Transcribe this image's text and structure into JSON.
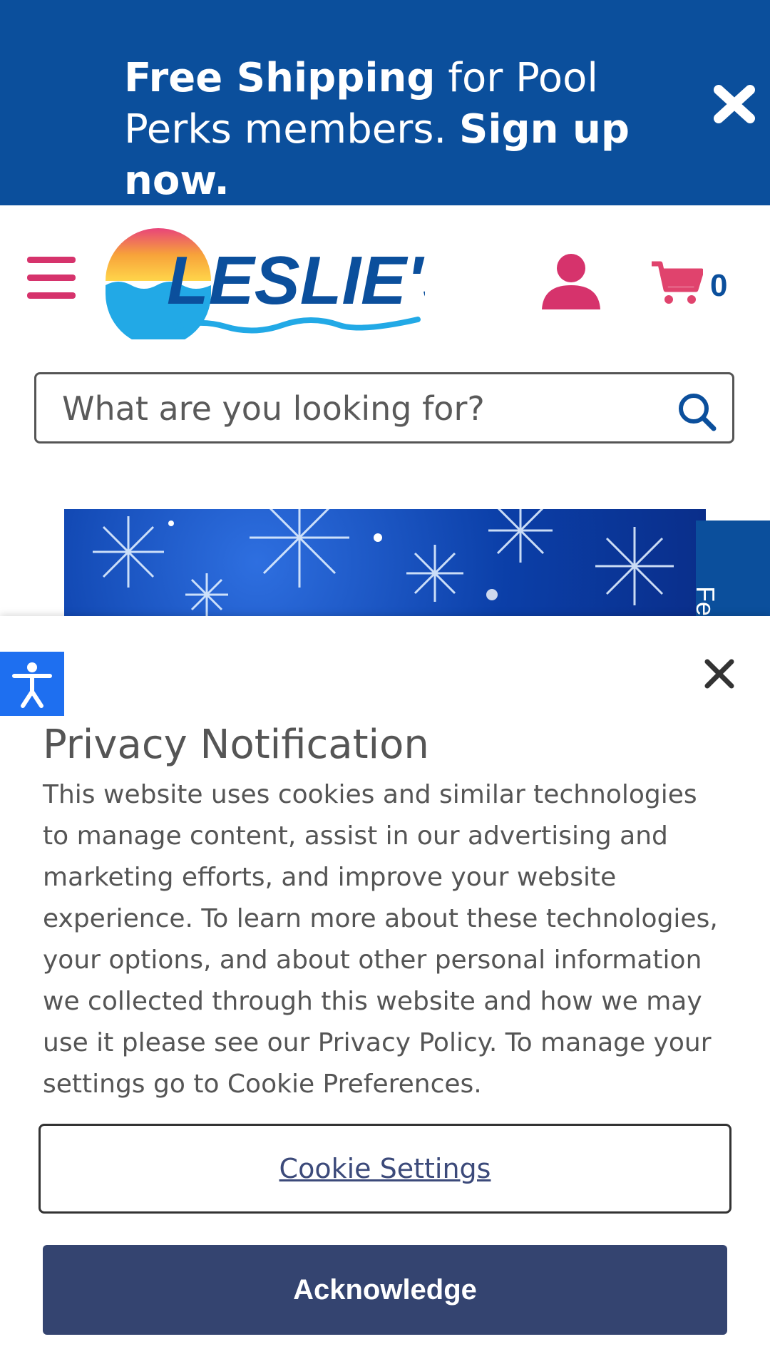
{
  "promo": {
    "part1_bold": "Free Shipping",
    "part2": " for Pool Perks members. ",
    "part3_bold": "Sign up now."
  },
  "header": {
    "logo_text": "LESLIE'S",
    "cart_count": "0"
  },
  "search": {
    "placeholder": "What are you looking for?"
  },
  "feedback_tab": {
    "label": "Fe"
  },
  "privacy": {
    "title": "Privacy Notification",
    "body": "This website uses cookies and similar technologies to manage content, assist in our advertising and marketing efforts, and improve your website experience. To learn more about these technologies, your options, and about other personal information we collected through this website and how we may use it please see our Privacy Policy. To manage your settings go to Cookie Preferences.",
    "cookie_settings_label": "Cookie Settings",
    "acknowledge_label": "Acknowledge"
  },
  "colors": {
    "brand_blue": "#0b4f9c",
    "accent_pink": "#d6336c",
    "button_navy": "#344470",
    "a11y_blue": "#1e6ff0"
  },
  "icons": [
    "close-icon",
    "hamburger-menu-icon",
    "account-icon",
    "cart-icon",
    "search-icon",
    "accessibility-icon"
  ]
}
